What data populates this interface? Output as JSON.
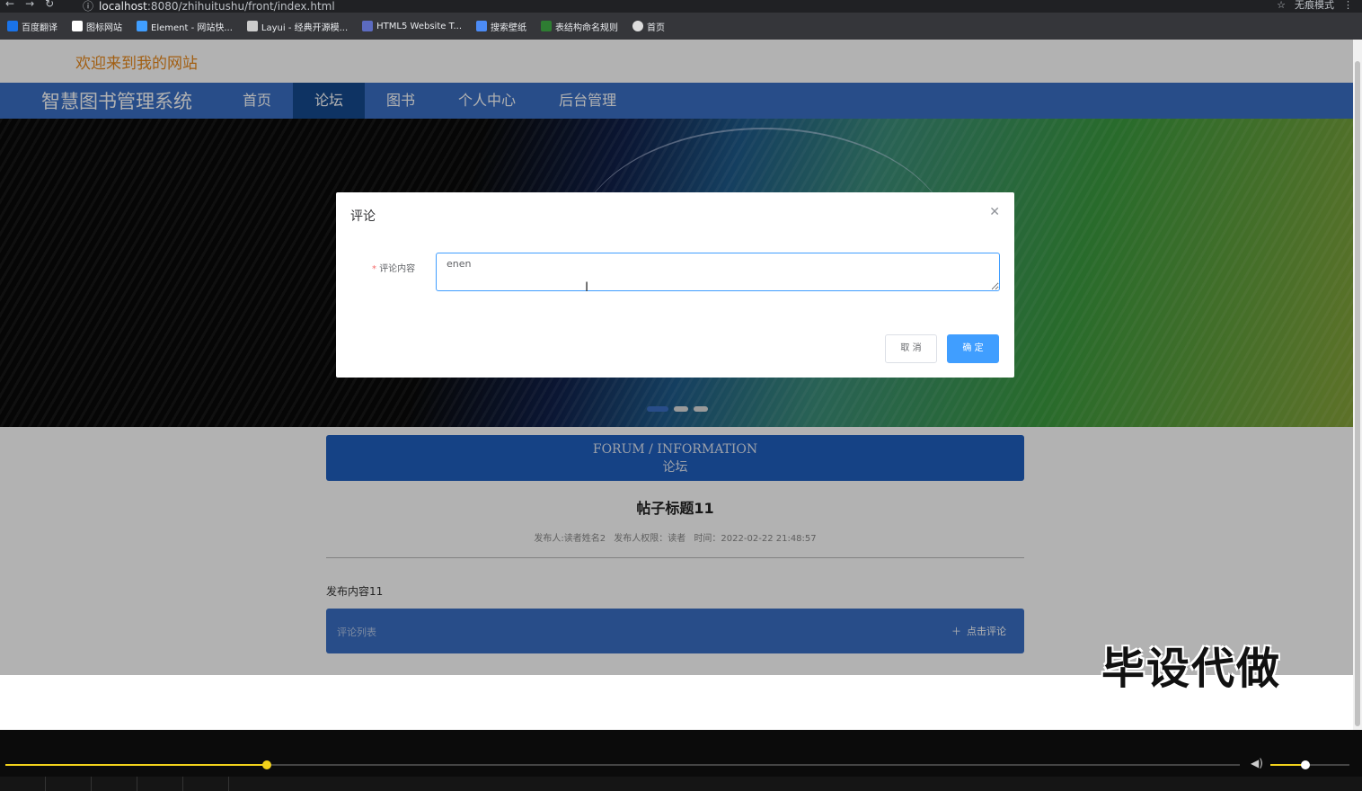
{
  "browser": {
    "url_host": "localhost",
    "url_rest": ":8080/zhihuitushu/front/index.html",
    "incognito_label": "无痕模式"
  },
  "bookmarks": [
    {
      "label": "百度翻译",
      "color": "#1a73e8"
    },
    {
      "label": "图标网站",
      "color": "#ffffff"
    },
    {
      "label": "Element - 网站快...",
      "color": "#409eff"
    },
    {
      "label": "Layui - 经典开源模...",
      "color": "#cccccc"
    },
    {
      "label": "HTML5 Website T...",
      "color": "#5c6bc0"
    },
    {
      "label": "搜索壁纸",
      "color": "#4c8bf5"
    },
    {
      "label": "表结构命名规则",
      "color": "#2e7d32"
    },
    {
      "label": "首页",
      "color": "#dddddd"
    }
  ],
  "header": {
    "welcome": "欢迎来到我的网站"
  },
  "nav": {
    "brand": "智慧图书管理系统",
    "items": [
      "首页",
      "论坛",
      "图书",
      "个人中心",
      "后台管理"
    ],
    "active_index": 1
  },
  "forum": {
    "heading_en": "FORUM / INFORMATION",
    "heading_zh": "论坛",
    "post_title": "帖子标题11",
    "meta_author": "发布人:读者姓名2",
    "meta_role": "发布人权限：读者",
    "meta_time": "时间：2022-02-22 21:48:57",
    "content": "发布内容11",
    "comment_label": "评论列表",
    "add_comment": "点击评论"
  },
  "dialog": {
    "title": "评论",
    "field_label": "评论内容",
    "field_value": "enen",
    "cancel": "取 消",
    "confirm": "确 定"
  },
  "watermark": "毕设代做",
  "player": {
    "progress": 0.212,
    "volume": 0.44
  },
  "colors": {
    "nav_bg": "#3a6fc4",
    "nav_active": "#154a8f",
    "welcome": "#e8891c",
    "primary_button": "#409eff"
  }
}
